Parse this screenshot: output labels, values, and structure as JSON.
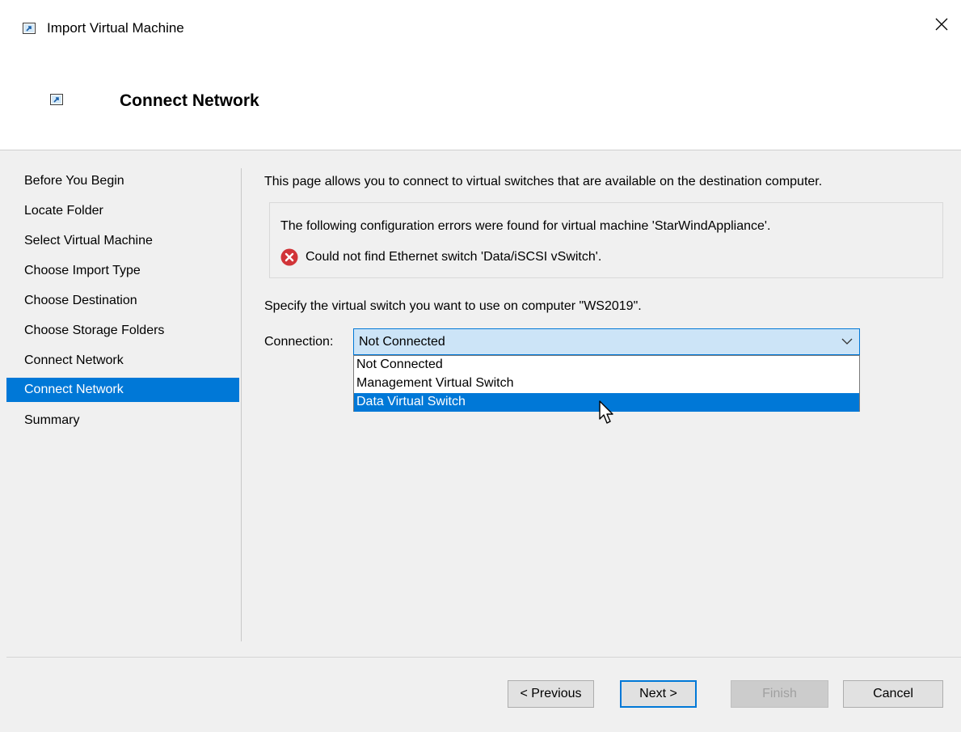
{
  "window": {
    "title": "Import Virtual Machine",
    "close_glyph": "✕"
  },
  "header": {
    "page_title": "Connect Network"
  },
  "nav": {
    "items": [
      {
        "label": "Before You Begin"
      },
      {
        "label": "Locate Folder"
      },
      {
        "label": "Select Virtual Machine"
      },
      {
        "label": "Choose Import Type"
      },
      {
        "label": "Choose Destination"
      },
      {
        "label": "Choose Storage Folders"
      },
      {
        "label": "Connect Network"
      },
      {
        "label": "Connect Network",
        "selected": true
      },
      {
        "label": "Summary"
      }
    ]
  },
  "content": {
    "intro": "This page allows you to connect to virtual switches that are available on the destination computer.",
    "errors_heading": "The following configuration errors were found for virtual machine 'StarWindAppliance'.",
    "error_message": "Could not find Ethernet switch 'Data/iSCSI vSwitch'.",
    "specify": "Specify the virtual switch you want to use on computer \"WS2019\".",
    "connection_label": "Connection:",
    "connection_value": "Not Connected",
    "options": [
      "Not Connected",
      "Management Virtual Switch",
      "Data Virtual Switch"
    ],
    "highlighted_option_index": 2
  },
  "buttons": {
    "previous": "< Previous",
    "next": "Next >",
    "finish": "Finish",
    "cancel": "Cancel"
  },
  "colors": {
    "accent": "#0078d7",
    "error": "#d13438",
    "combo_bg": "#cce4f7"
  },
  "icons": [
    "import-vm-icon",
    "close-icon",
    "error-icon",
    "chevron-down-icon",
    "mouse-pointer-icon"
  ]
}
